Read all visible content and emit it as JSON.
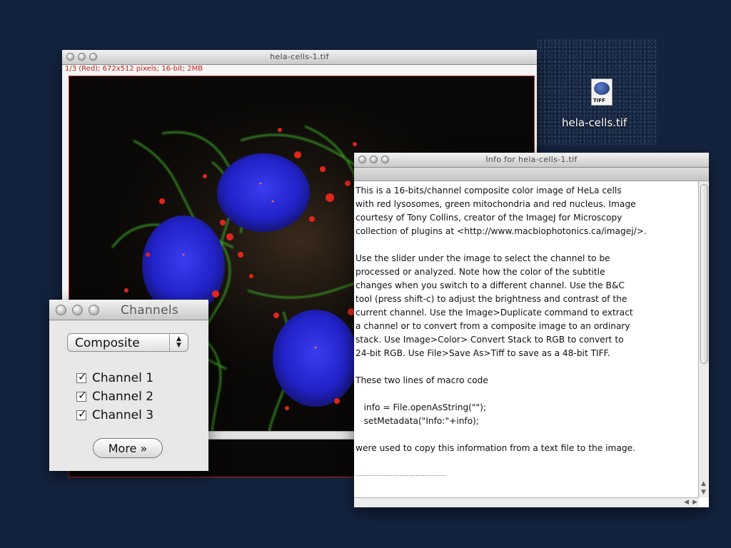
{
  "desktop": {
    "background": "#13233f",
    "icon": {
      "name": "hela-cells.tif",
      "badge": "TIFF",
      "icon": "tiff-file-icon"
    }
  },
  "image_window": {
    "title": "hela-cells-1.tif",
    "subtitle": "1/3 (Red); 672x512 pixels; 16-bit; 2MB",
    "subtitle_color": "#c0231d"
  },
  "info_window": {
    "title": "Info for hela-cells-1.tif",
    "paragraphs": [
      "This is a 16-bits/channel composite color image of HeLa cells\nwith red lysosomes, green mitochondria and red nucleus. Image\ncourtesy of Tony Collins, creator of the ImageJ for Microscopy\ncollection of plugins at <http://www.macbiophotonics.ca/imagej/>.",
      "Use the slider under the image to select the channel to be\nprocessed or analyzed. Note how the color of the subtitle\nchanges when you switch to a different channel. Use the B&C\ntool (press shift-c) to adjust the brightness and contrast of the\ncurrent channel. Use the Image>Duplicate command to extract\na channel or to convert from a composite image to an ordinary\nstack. Use Image>Color> Convert Stack to RGB to convert to\n24-bit RGB. Use File>Save As>Tiff to save as a 48-bit TIFF.",
      "These two lines of macro code",
      "   info = File.openAsString(\"\");\n   setMetadata(\"Info:\"+info);",
      "were used to copy this information from a text file to the image."
    ],
    "trailing_rule": "-----------------------------"
  },
  "channels_window": {
    "title": "Channels",
    "mode_select": {
      "value": "Composite",
      "stepper_up": "▲",
      "stepper_down": "▼"
    },
    "channels": [
      {
        "label": "Channel 1",
        "checked": true
      },
      {
        "label": "Channel 2",
        "checked": true
      },
      {
        "label": "Channel 3",
        "checked": true
      }
    ],
    "more_button": "More »"
  },
  "colors": {
    "lysosome_red": "#e0261c",
    "mitochondria_green": "#3cae2c",
    "nucleus_blue": "#2a2fd8"
  }
}
